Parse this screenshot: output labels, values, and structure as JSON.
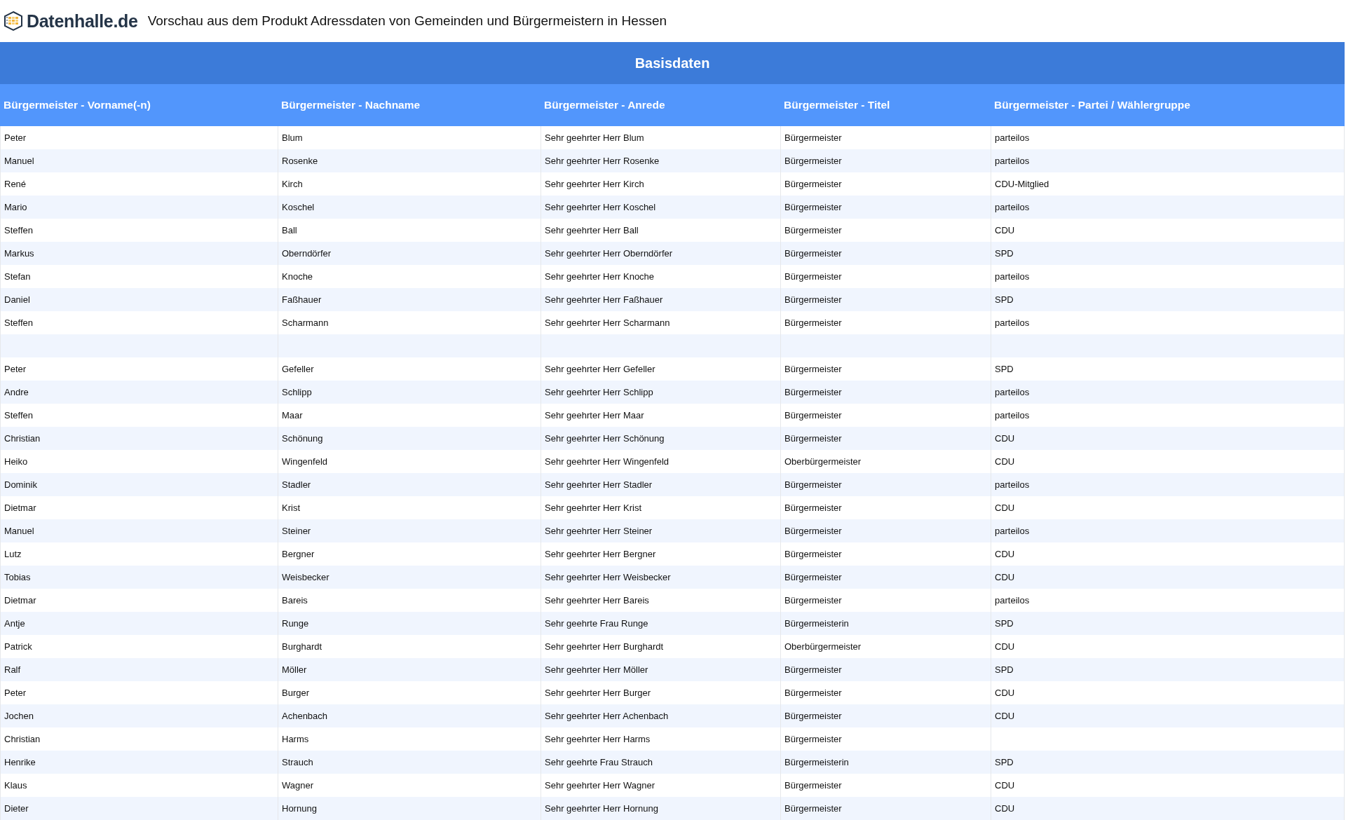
{
  "header": {
    "logo_text": "Datenhalle.de",
    "title": "Vorschau aus dem Produkt Adressdaten von Gemeinden und Bürgermeistern in Hessen"
  },
  "table": {
    "group_title": "Basisdaten",
    "columns": [
      "Bürgermeister - Vorname(-n)",
      "Bürgermeister - Nachname",
      "Bürgermeister - Anrede",
      "Bürgermeister - Titel",
      "Bürgermeister - Partei / Wählergruppe"
    ],
    "rows": [
      {
        "kind": "data",
        "cells": [
          "Peter",
          "Blum",
          "Sehr geehrter Herr Blum",
          "Bürgermeister",
          "parteilos"
        ]
      },
      {
        "kind": "data",
        "cells": [
          "Manuel",
          "Rosenke",
          "Sehr geehrter Herr Rosenke",
          "Bürgermeister",
          "parteilos"
        ]
      },
      {
        "kind": "data",
        "cells": [
          "René",
          "Kirch",
          "Sehr geehrter Herr Kirch",
          "Bürgermeister",
          "CDU-Mitglied"
        ]
      },
      {
        "kind": "data",
        "cells": [
          "Mario",
          "Koschel",
          "Sehr geehrter Herr Koschel",
          "Bürgermeister",
          "parteilos"
        ]
      },
      {
        "kind": "data",
        "cells": [
          "Steffen",
          "Ball",
          "Sehr geehrter Herr Ball",
          "Bürgermeister",
          "CDU"
        ]
      },
      {
        "kind": "data",
        "cells": [
          "Markus",
          "Oberndörfer",
          "Sehr geehrter Herr Oberndörfer",
          "Bürgermeister",
          "SPD"
        ]
      },
      {
        "kind": "data",
        "cells": [
          "Stefan",
          "Knoche",
          "Sehr geehrter Herr Knoche",
          "Bürgermeister",
          "parteilos"
        ]
      },
      {
        "kind": "data",
        "cells": [
          "Daniel",
          "Faßhauer",
          "Sehr geehrter Herr Faßhauer",
          "Bürgermeister",
          "SPD"
        ]
      },
      {
        "kind": "data",
        "cells": [
          "Steffen",
          "Scharmann",
          "Sehr geehrter Herr Scharmann",
          "Bürgermeister",
          "parteilos"
        ]
      },
      {
        "kind": "empty"
      },
      {
        "kind": "data",
        "cells": [
          "Peter",
          "Gefeller",
          "Sehr geehrter Herr Gefeller",
          "Bürgermeister",
          "SPD"
        ]
      },
      {
        "kind": "data",
        "cells": [
          "Andre",
          "Schlipp",
          "Sehr geehrter Herr Schlipp",
          "Bürgermeister",
          "parteilos"
        ]
      },
      {
        "kind": "data",
        "cells": [
          "Steffen",
          "Maar",
          "Sehr geehrter Herr Maar",
          "Bürgermeister",
          "parteilos"
        ]
      },
      {
        "kind": "data",
        "cells": [
          "Christian",
          "Schönung",
          "Sehr geehrter Herr Schönung",
          "Bürgermeister",
          "CDU"
        ]
      },
      {
        "kind": "data",
        "cells": [
          "Heiko",
          "Wingenfeld",
          "Sehr geehrter Herr Wingenfeld",
          "Oberbürgermeister",
          "CDU"
        ]
      },
      {
        "kind": "data",
        "cells": [
          "Dominik",
          "Stadler",
          "Sehr geehrter Herr Stadler",
          "Bürgermeister",
          "parteilos"
        ]
      },
      {
        "kind": "data",
        "cells": [
          "Dietmar",
          "Krist",
          "Sehr geehrter Herr Krist",
          "Bürgermeister",
          "CDU"
        ]
      },
      {
        "kind": "data",
        "cells": [
          "Manuel",
          "Steiner",
          "Sehr geehrter Herr Steiner",
          "Bürgermeister",
          "parteilos"
        ]
      },
      {
        "kind": "data",
        "cells": [
          "Lutz",
          "Bergner",
          "Sehr geehrter Herr Bergner",
          "Bürgermeister",
          "CDU"
        ]
      },
      {
        "kind": "data",
        "cells": [
          "Tobias",
          "Weisbecker",
          "Sehr geehrter Herr Weisbecker",
          "Bürgermeister",
          "CDU"
        ]
      },
      {
        "kind": "data",
        "cells": [
          "Dietmar",
          "Bareis",
          "Sehr geehrter Herr Bareis",
          "Bürgermeister",
          "parteilos"
        ]
      },
      {
        "kind": "data",
        "cells": [
          "Antje",
          "Runge",
          "Sehr geehrte Frau Runge",
          "Bürgermeisterin",
          "SPD"
        ]
      },
      {
        "kind": "data",
        "cells": [
          "Patrick",
          "Burghardt",
          "Sehr geehrter Herr Burghardt",
          "Oberbürgermeister",
          "CDU"
        ]
      },
      {
        "kind": "data",
        "cells": [
          "Ralf",
          "Möller",
          "Sehr geehrter Herr Möller",
          "Bürgermeister",
          "SPD"
        ]
      },
      {
        "kind": "data",
        "cells": [
          "Peter",
          "Burger",
          "Sehr geehrter Herr Burger",
          "Bürgermeister",
          "CDU"
        ]
      },
      {
        "kind": "data",
        "cells": [
          "Jochen",
          "Achenbach",
          "Sehr geehrter Herr Achenbach",
          "Bürgermeister",
          "CDU"
        ]
      },
      {
        "kind": "data",
        "cells": [
          "Christian",
          "Harms",
          "Sehr geehrter Herr Harms",
          "Bürgermeister"
        ]
      },
      {
        "kind": "data",
        "cells": [
          "Henrike",
          "Strauch",
          "Sehr geehrte Frau Strauch",
          "Bürgermeisterin",
          "SPD"
        ]
      },
      {
        "kind": "data",
        "cells": [
          "Klaus",
          "Wagner",
          "Sehr geehrter Herr Wagner",
          "Bürgermeister",
          "CDU"
        ]
      },
      {
        "kind": "data",
        "cells": [
          "Dieter",
          "Hornung",
          "Sehr geehrter Herr Hornung",
          "Bürgermeister",
          "CDU"
        ]
      }
    ]
  }
}
